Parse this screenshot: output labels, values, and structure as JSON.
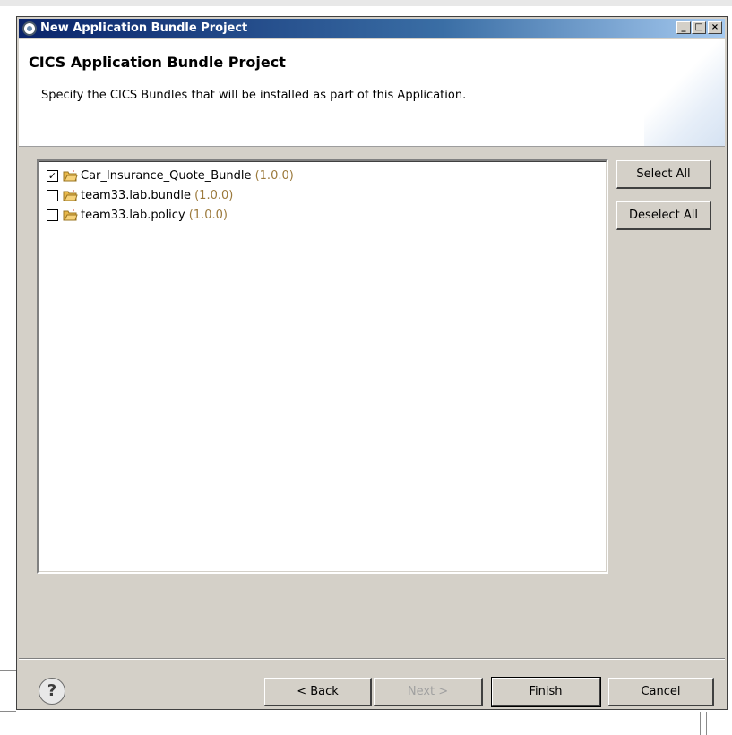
{
  "window": {
    "title": "New Application Bundle Project",
    "controls": {
      "minimize": "_",
      "maximize": "□",
      "close": "×"
    }
  },
  "header": {
    "title": "CICS Application Bundle Project",
    "description": "Specify the CICS Bundles that will be installed as part of this Application."
  },
  "bundles": [
    {
      "name": "Car_Insurance_Quote_Bundle",
      "version": "(1.0.0)",
      "checked": true
    },
    {
      "name": "team33.lab.bundle",
      "version": "(1.0.0)",
      "checked": false
    },
    {
      "name": "team33.lab.policy",
      "version": "(1.0.0)",
      "checked": false
    }
  ],
  "side_buttons": {
    "select_all": "Select All",
    "deselect_all": "Deselect All"
  },
  "footer": {
    "help": "?",
    "back": "< Back",
    "next": "Next >",
    "finish": "Finish",
    "cancel": "Cancel"
  },
  "colors": {
    "version_text": "#9c7a3c",
    "titlebar_start": "#0a246a",
    "folder": "#e8b84a"
  },
  "icons": {
    "app": "app-gear-icon",
    "folder": "project-folder-icon",
    "help": "help-icon"
  }
}
